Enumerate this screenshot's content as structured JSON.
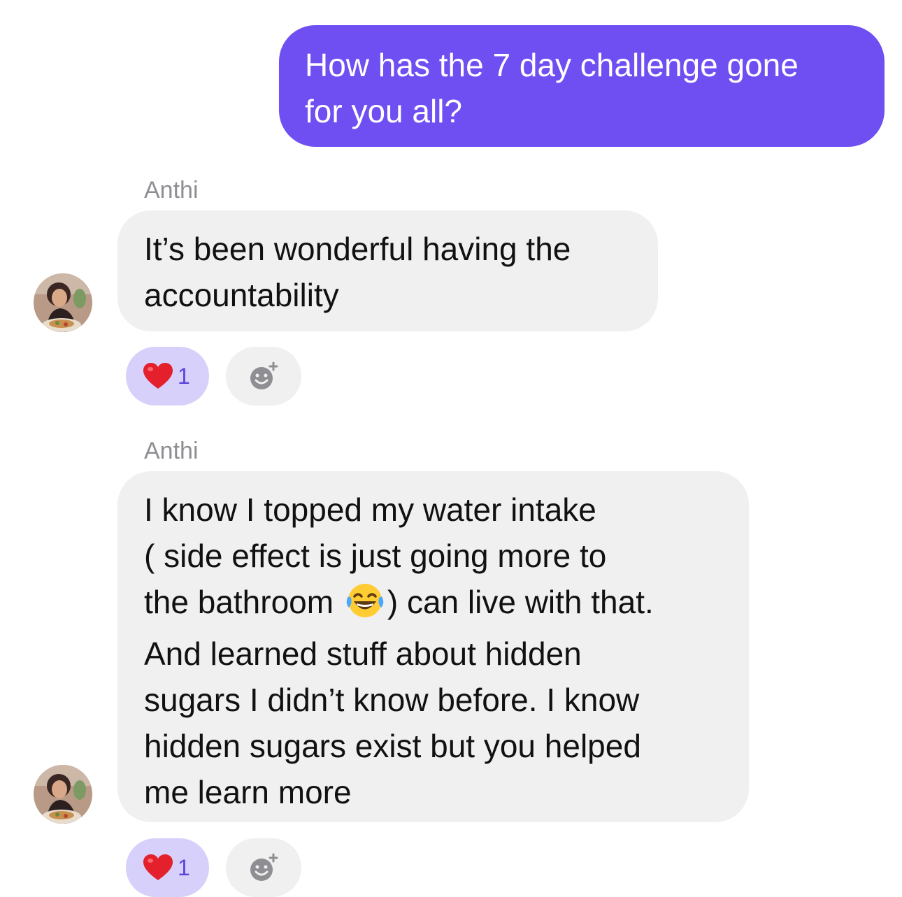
{
  "outgoing_message": {
    "text": "How has the 7 day challenge gone\nfor you all?",
    "color": "#6f4ef2"
  },
  "messages": [
    {
      "sender": "Anthi",
      "text": "It’s been wonderful having the\naccountability",
      "reaction": {
        "emoji": "heart-emoji",
        "count": "1"
      }
    },
    {
      "sender": "Anthi",
      "text_before_emoji": "I  know I topped my water intake\n( side effect is just going more to\nthe bathroom ",
      "inline_emoji": "laughing-tears-emoji",
      "text_after_emoji": ") can live with that.\nAnd learned stuff about hidden\nsugars I didn’t know before. I know\nhidden sugars exist but you helped\nme learn more",
      "reaction": {
        "emoji": "heart-emoji",
        "count": "1"
      }
    }
  ],
  "colors": {
    "incoming_bubble": "#f0f0f0",
    "reaction_pill": "#d7d0fb",
    "reaction_count": "#5b45d9",
    "sender_name": "#8e8e93"
  }
}
